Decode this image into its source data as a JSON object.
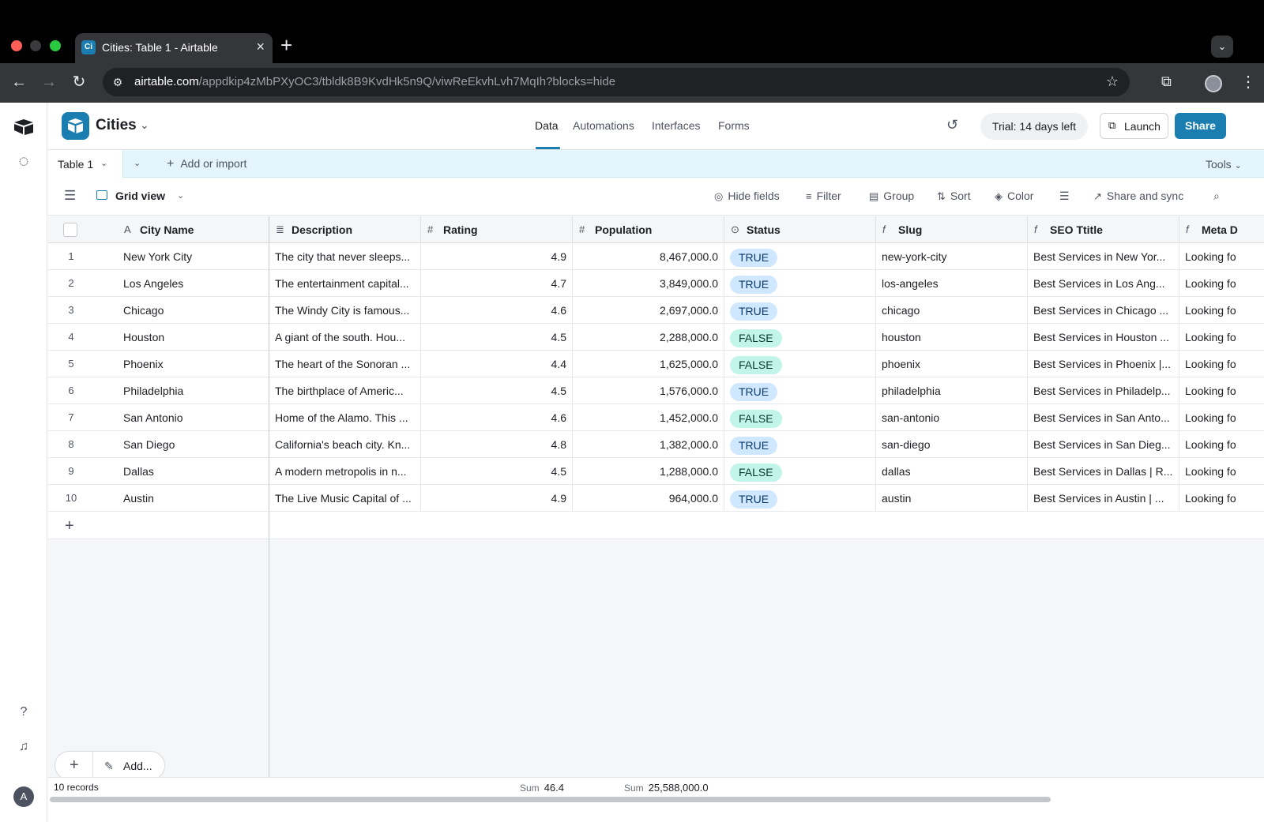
{
  "browser": {
    "tab_title": "Cities: Table 1 - Airtable",
    "tab_favicon_text": "Ci",
    "url_host": "airtable.com",
    "url_path": "/appdkip4zMbPXyOC3/tbldk8B9KvdHk5n9Q/viwReEkvhLvh7MqIh?blocks=hide"
  },
  "header": {
    "base_name": "Cities",
    "tabs": [
      "Data",
      "Automations",
      "Interfaces",
      "Forms"
    ],
    "active_tab": "Data",
    "trial_label": "Trial: 14 days left",
    "launch_label": "Launch",
    "share_label": "Share"
  },
  "tablebar": {
    "table_name": "Table 1",
    "add_label": "Add or import",
    "tools_label": "Tools"
  },
  "viewbar": {
    "view_name": "Grid view",
    "hide_fields": "Hide fields",
    "filter": "Filter",
    "group": "Group",
    "sort": "Sort",
    "color": "Color",
    "share_sync": "Share and sync"
  },
  "columns": {
    "city": "City Name",
    "desc": "Description",
    "rating": "Rating",
    "population": "Population",
    "status": "Status",
    "slug": "Slug",
    "seo": "SEO Ttitle",
    "meta": "Meta D"
  },
  "rows": [
    {
      "n": "1",
      "city": "New York City",
      "desc": "The city that never sleeps...",
      "rating": "4.9",
      "population": "8,467,000.0",
      "status": "TRUE",
      "slug": "new-york-city",
      "seo": "Best Services in New Yor...",
      "meta": "Looking fo"
    },
    {
      "n": "2",
      "city": "Los Angeles",
      "desc": "The entertainment capital...",
      "rating": "4.7",
      "population": "3,849,000.0",
      "status": "TRUE",
      "slug": "los-angeles",
      "seo": "Best Services in Los Ang...",
      "meta": "Looking fo"
    },
    {
      "n": "3",
      "city": "Chicago",
      "desc": "The Windy City is famous...",
      "rating": "4.6",
      "population": "2,697,000.0",
      "status": "TRUE",
      "slug": "chicago",
      "seo": "Best Services in Chicago ...",
      "meta": "Looking fo"
    },
    {
      "n": "4",
      "city": "Houston",
      "desc": "A giant of the south. Hou...",
      "rating": "4.5",
      "population": "2,288,000.0",
      "status": "FALSE",
      "slug": "houston",
      "seo": "Best Services in Houston ...",
      "meta": "Looking fo"
    },
    {
      "n": "5",
      "city": "Phoenix",
      "desc": "The heart of the Sonoran ...",
      "rating": "4.4",
      "population": "1,625,000.0",
      "status": "FALSE",
      "slug": "phoenix",
      "seo": "Best Services in Phoenix |...",
      "meta": "Looking fo"
    },
    {
      "n": "6",
      "city": "Philadelphia",
      "desc": "The birthplace of Americ...",
      "rating": "4.5",
      "population": "1,576,000.0",
      "status": "TRUE",
      "slug": "philadelphia",
      "seo": "Best Services in Philadelp...",
      "meta": "Looking fo"
    },
    {
      "n": "7",
      "city": "San Antonio",
      "desc": "Home of the Alamo. This ...",
      "rating": "4.6",
      "population": "1,452,000.0",
      "status": "FALSE",
      "slug": "san-antonio",
      "seo": "Best Services in San Anto...",
      "meta": "Looking fo"
    },
    {
      "n": "8",
      "city": "San Diego",
      "desc": "California's beach city. Kn...",
      "rating": "4.8",
      "population": "1,382,000.0",
      "status": "TRUE",
      "slug": "san-diego",
      "seo": "Best Services in San Dieg...",
      "meta": "Looking fo"
    },
    {
      "n": "9",
      "city": "Dallas",
      "desc": "A modern metropolis in n...",
      "rating": "4.5",
      "population": "1,288,000.0",
      "status": "FALSE",
      "slug": "dallas",
      "seo": "Best Services in Dallas | R...",
      "meta": "Looking fo"
    },
    {
      "n": "10",
      "city": "Austin",
      "desc": "The Live Music Capital of ...",
      "rating": "4.9",
      "population": "964,000.0",
      "status": "TRUE",
      "slug": "austin",
      "seo": "Best Services in Austin | ...",
      "meta": "Looking fo"
    }
  ],
  "add_menu_label": "Add...",
  "footer": {
    "records": "10 records",
    "sum_label": "Sum",
    "rating_sum": "46.4",
    "population_sum": "25,588,000.0"
  },
  "colors": {
    "accent": "#1a7fb0",
    "true_pill": "#cfe8ff",
    "false_pill": "#c2f5e9",
    "table_bar": "#e4f6fc"
  }
}
